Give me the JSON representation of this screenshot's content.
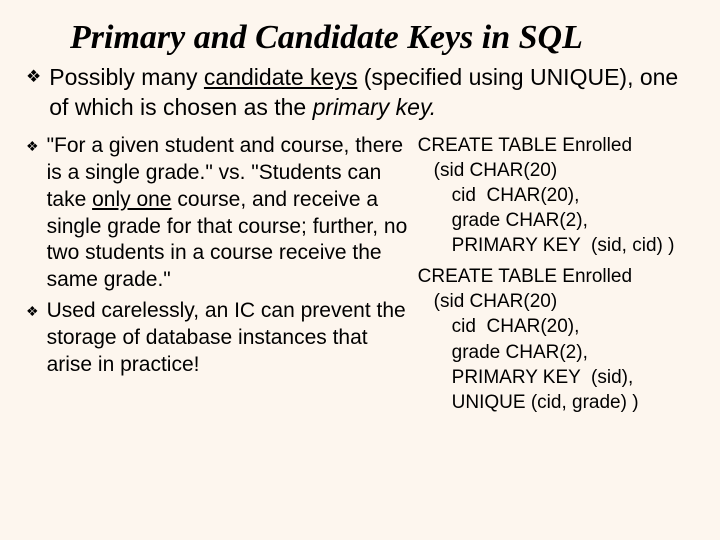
{
  "title": "Primary and Candidate Keys in SQL",
  "top": {
    "pre": "Possibly many ",
    "candidate": "candidate keys",
    "mid1": "  (specified using ",
    "unique": "UNIQUE",
    "mid2": "), one of which is chosen as the ",
    "primary": "primary key.",
    "post": ""
  },
  "left": {
    "b1": {
      "t1": "\"For a given student and course, there is a single grade.\" vs. \"Students can take ",
      "only": "only one",
      "t2": " course, and receive a single grade for that course; further, no two students in a course receive the same grade.\""
    },
    "b2": "Used carelessly, an IC can prevent the storage of database instances that arise in practice!"
  },
  "code1": {
    "l1a": "CREATE TABLE ",
    "l1b": "Enrolled",
    "l2a": "(sid ",
    "l2b": "CHAR",
    "l2c": "(20)",
    "l3a": "cid  ",
    "l3b": "CHAR(20),",
    "l4a": "grade ",
    "l4b": "CHAR",
    "l4c": "(2),",
    "l5a": "PRIMARY KEY ",
    "l5b": " (sid, cid) )"
  },
  "code2": {
    "l1a": "CREATE TABLE ",
    "l1b": "Enrolled",
    "l2a": "(sid ",
    "l2b": "CHAR",
    "l2c": "(20)",
    "l3a": "cid  ",
    "l3b": "CHAR(20),",
    "l4a": "grade ",
    "l4b": "CHAR",
    "l4c": "(2),",
    "l5a": "PRIMARY KEY ",
    "l5b": " (sid),",
    "l6a": "UNIQUE ",
    "l6b": "(cid, grade) )"
  }
}
